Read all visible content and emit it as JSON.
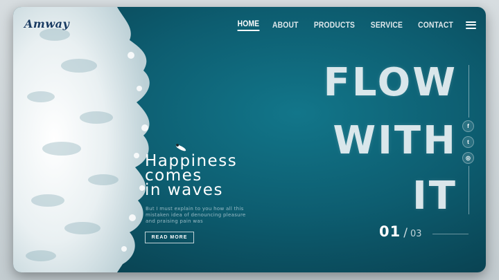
{
  "brand": {
    "logo_text": "Amway"
  },
  "nav": {
    "items": [
      {
        "label": "HOME",
        "active": true
      },
      {
        "label": "ABOUT",
        "active": false
      },
      {
        "label": "PRODUCTS",
        "active": false
      },
      {
        "label": "SERVICE",
        "active": false
      },
      {
        "label": "CONTACT",
        "active": false
      }
    ],
    "menu_icon": "hamburger-icon"
  },
  "hero": {
    "big_title": [
      "FLOW",
      "WITH",
      "IT"
    ],
    "headline": [
      "Happiness",
      "comes",
      "in waves"
    ],
    "paragraph": "But I must explain to you how all this mistaken idea of denouncing pleasure and praising pain was",
    "cta_label": "READ MORE"
  },
  "social": [
    {
      "icon": "facebook-icon",
      "glyph": "f"
    },
    {
      "icon": "twitter-icon",
      "glyph": "t"
    },
    {
      "icon": "instagram-icon",
      "glyph": "◎"
    }
  ],
  "pager": {
    "current": "01",
    "separator": "/",
    "total": "03"
  },
  "colors": {
    "ocean": "#0d5d70",
    "text": "#ffffff",
    "logo": "#1a3c63"
  }
}
